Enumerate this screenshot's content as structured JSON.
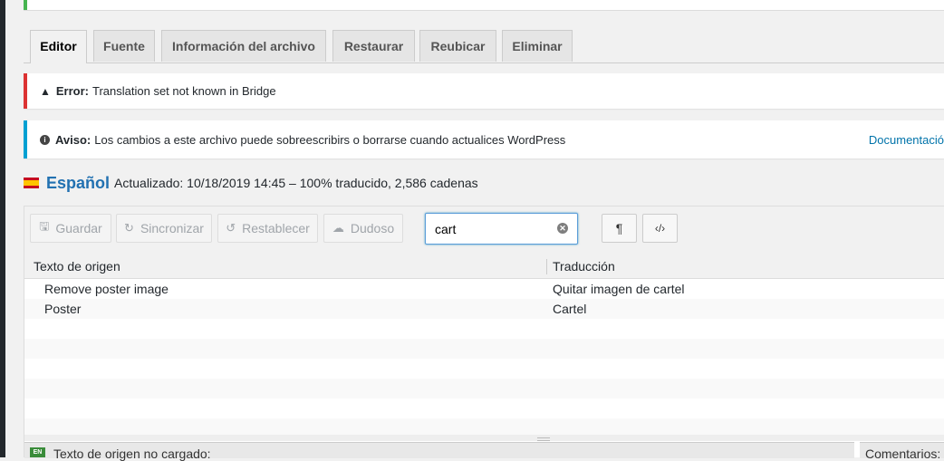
{
  "tabs": [
    {
      "label": "Editor",
      "active": true
    },
    {
      "label": "Fuente"
    },
    {
      "label": "Información del archivo"
    },
    {
      "label": "Restaurar"
    },
    {
      "label": "Reubicar"
    },
    {
      "label": "Eliminar"
    }
  ],
  "notices": {
    "error": {
      "icon": "warning-icon",
      "strong": "Error:",
      "text": "Translation set not known in Bridge",
      "color": "#dc3232"
    },
    "warning": {
      "icon": "info-icon",
      "strong": "Aviso:",
      "text": "Los cambios a este archivo puede sobreescribirs o borrarse cuando actualices WordPress",
      "color": "#00a0d2",
      "link": "Documentació"
    }
  },
  "language": {
    "name": "Español",
    "meta": "Actualizado: 10/18/2019 14:45 – 100% traducido, 2,586 cadenas",
    "flag": "spain-flag-icon"
  },
  "toolbar": {
    "save": "Guardar",
    "sync": "Sincronizar",
    "revert": "Restablecer",
    "fuzzy": "Dudoso",
    "search_value": "cart",
    "invisibles_icon": "¶",
    "code_icon": "‹/›"
  },
  "grid": {
    "source_header": "Texto de origen",
    "target_header": "Traducción",
    "rows": [
      {
        "source": "Remove poster image",
        "target": "Quitar imagen de cartel"
      },
      {
        "source": "Poster",
        "target": "Cartel"
      }
    ]
  },
  "panes": {
    "lang_tag": "EN",
    "source_label": "Texto de origen no cargado:",
    "comments_label": "Comentarios:"
  }
}
